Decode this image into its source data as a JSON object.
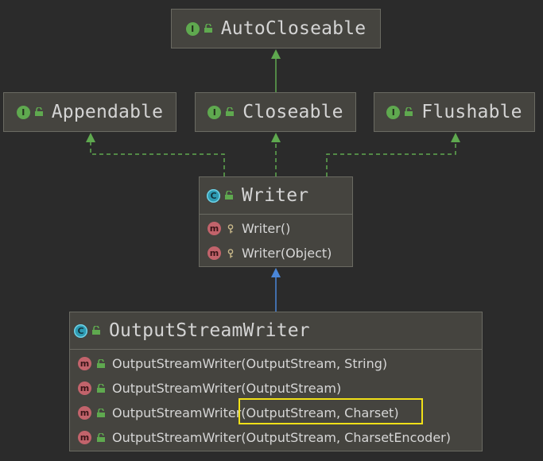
{
  "nodes": {
    "autocloseable": {
      "title": "AutoCloseable",
      "kind": "I"
    },
    "appendable": {
      "title": "Appendable",
      "kind": "I"
    },
    "closeable": {
      "title": "Closeable",
      "kind": "I"
    },
    "flushable": {
      "title": "Flushable",
      "kind": "I"
    },
    "writer": {
      "title": "Writer",
      "kind": "C",
      "members": [
        {
          "icon": "m",
          "label": "Writer()"
        },
        {
          "icon": "m",
          "label": "Writer(Object)"
        }
      ]
    },
    "outputstreamwriter": {
      "title": "OutputStreamWriter",
      "kind": "C",
      "members": [
        {
          "icon": "m",
          "label": "OutputStreamWriter(OutputStream, String)"
        },
        {
          "icon": "m",
          "label": "OutputStreamWriter(OutputStream)"
        },
        {
          "icon": "m",
          "label": "OutputStreamWriter(OutputStream, Charset)"
        },
        {
          "icon": "m",
          "label": "OutputStreamWriter(OutputStream, CharsetEncoder)"
        }
      ]
    }
  },
  "edges": [
    {
      "from": "closeable",
      "to": "autocloseable",
      "type": "interface-extends"
    },
    {
      "from": "writer",
      "to": "appendable",
      "type": "implements"
    },
    {
      "from": "writer",
      "to": "closeable",
      "type": "implements"
    },
    {
      "from": "writer",
      "to": "flushable",
      "type": "implements"
    },
    {
      "from": "outputstreamwriter",
      "to": "writer",
      "type": "extends"
    }
  ],
  "colors": {
    "background": "#2b2b2b",
    "node_fill": "#45443f",
    "interface_edge": "#5fa94f",
    "class_edge": "#4a86d8",
    "highlight": "#f0e018"
  }
}
